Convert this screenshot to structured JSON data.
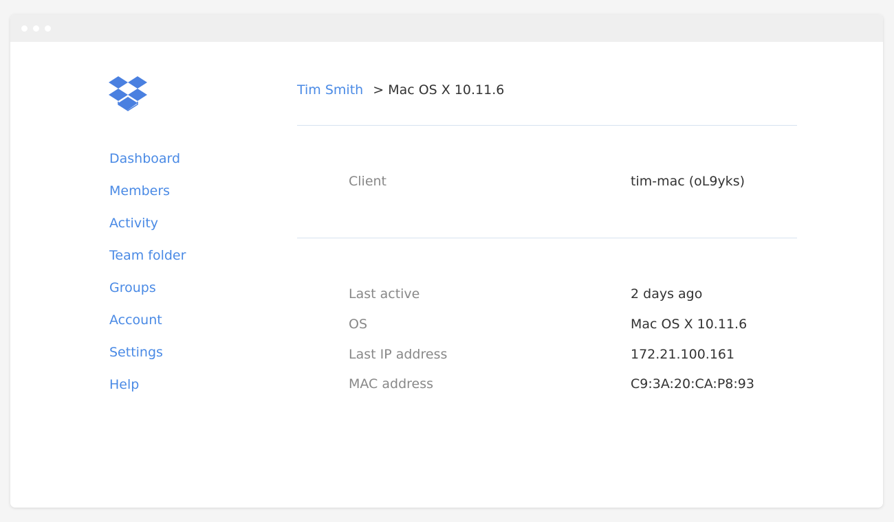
{
  "window": {
    "title_dots": [
      "close",
      "minimize",
      "maximize"
    ]
  },
  "brand": {
    "logo": "dropbox-logo-icon",
    "color": "#4a80e0"
  },
  "sidebar": {
    "items": [
      {
        "label": "Dashboard"
      },
      {
        "label": "Members"
      },
      {
        "label": "Activity"
      },
      {
        "label": "Team folder"
      },
      {
        "label": "Groups"
      },
      {
        "label": "Account"
      },
      {
        "label": "Settings"
      },
      {
        "label": "Help"
      }
    ]
  },
  "breadcrumb": {
    "parent": "Tim Smith",
    "separator": ">",
    "current": "Mac OS X 10.11.6"
  },
  "client": {
    "label": "Client",
    "value": "tim-mac (oL9yks)"
  },
  "details": [
    {
      "label": "Last active",
      "value": "2 days ago"
    },
    {
      "label": "OS",
      "value": "Mac OS X 10.11.6"
    },
    {
      "label": "Last IP address",
      "value": "172.21.100.161"
    },
    {
      "label": "MAC address",
      "value": "C9:3A:20:CA:P8:93"
    }
  ],
  "colors": {
    "link": "#4a8ae5",
    "text": "#333333",
    "muted": "#888888",
    "divider": "#d6e2f0"
  }
}
